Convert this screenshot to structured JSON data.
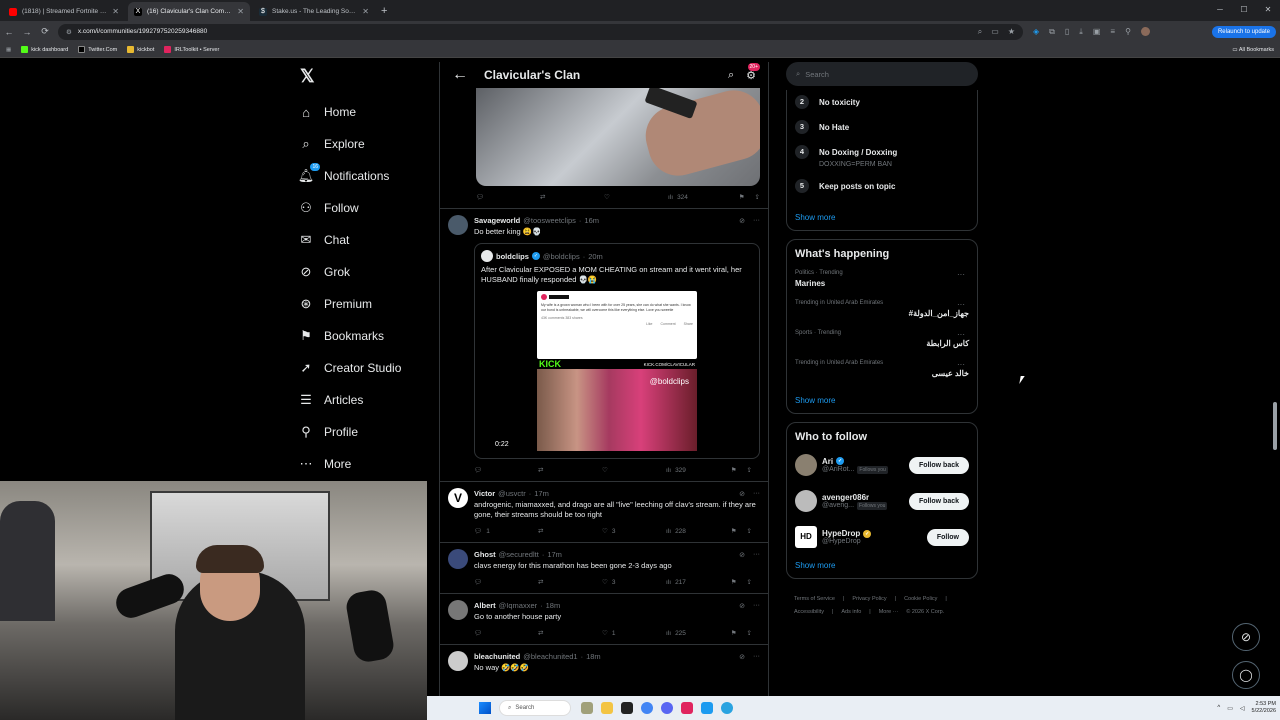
{
  "browser": {
    "tabs": [
      {
        "title": "(1818) | Streamed Fortnite for 1",
        "favicon_color": "#ff0000",
        "active": false
      },
      {
        "title": "(16) Clavicular's Clan Communi",
        "favicon_color": "#000000",
        "active": true
      },
      {
        "title": "Stake.us - The Leading Social C",
        "favicon_color": "#1a2c38",
        "active": false
      }
    ],
    "url": "x.com/i/communities/1992797520259346880",
    "relaunch_label": "Relaunch to update",
    "bookmarks": [
      {
        "label": "kick dashboard",
        "color": "#53fc18"
      },
      {
        "label": "Twitter.Com",
        "color": "#000000"
      },
      {
        "label": "kickbot",
        "color": "#e8b931"
      },
      {
        "label": "IRLToolkit • Server",
        "color": "#e0245e"
      }
    ],
    "all_bookmarks": "All Bookmarks"
  },
  "nav": {
    "items": [
      {
        "label": "Home",
        "icon": "home-icon"
      },
      {
        "label": "Explore",
        "icon": "search-icon"
      },
      {
        "label": "Notifications",
        "icon": "bell-icon",
        "badge": "16"
      },
      {
        "label": "Follow",
        "icon": "add-person-icon"
      },
      {
        "label": "Chat",
        "icon": "mail-icon"
      },
      {
        "label": "Grok",
        "icon": "grok-icon"
      },
      {
        "label": "Premium",
        "icon": "premium-icon"
      },
      {
        "label": "Bookmarks",
        "icon": "bookmark-icon"
      },
      {
        "label": "Creator Studio",
        "icon": "rocket-icon"
      },
      {
        "label": "Articles",
        "icon": "article-icon"
      },
      {
        "label": "Profile",
        "icon": "person-icon"
      },
      {
        "label": "More",
        "icon": "more-icon"
      }
    ]
  },
  "feed": {
    "title": "Clavicular's Clan",
    "header_badge": "20+",
    "first_post_stats": {
      "views": "324"
    },
    "posts": [
      {
        "name": "Savageworld",
        "handle": "@toosweetclips",
        "time": "16m",
        "text": "Do better king 😩💀",
        "avatar_color": "#4a5a6a",
        "quote": {
          "name": "boldclips",
          "handle": "@boldclips",
          "time": "20m",
          "text": "After Clavicular EXPOSED a MOM CHEATING on stream and it went viral, her HUSBAND finally responded 💀😭",
          "kick_text": "KICK",
          "kick_url": "KICK.COM/CLAVICULAR",
          "video_tag": "@boldclips",
          "duration": "0:22",
          "screenshot_text": "My wife is a grown woman who I been with for over 25 years, she can do what she wants. I know our bond is unbreakable, we will overcome this like everything else. Love you sweetie",
          "screenshot_stats": "43K comments  383 shares",
          "screenshot_actions": [
            "Like",
            "Comment",
            "Share"
          ]
        },
        "stats": {
          "replies": "",
          "reposts": "",
          "likes": "",
          "views": "329"
        }
      },
      {
        "name": "Victor",
        "handle": "@usvctr",
        "time": "17m",
        "text": "androgenic, miamaxxed, and drago are all \"live\" leeching off clav's stream. if they are gone, their streams should be too right",
        "avatar_color": "#ffffff",
        "stats": {
          "replies": "1",
          "reposts": "",
          "likes": "3",
          "views": "228"
        }
      },
      {
        "name": "Ghost",
        "handle": "@securedltt",
        "time": "17m",
        "text": "clavs energy for this marathon has been gone 2-3 days ago",
        "avatar_color": "#3a4a7a",
        "stats": {
          "replies": "",
          "reposts": "",
          "likes": "3",
          "views": "217"
        }
      },
      {
        "name": "Albert",
        "handle": "@Iqmaxxer",
        "time": "18m",
        "text": "Go to another house party",
        "avatar_color": "#777777",
        "stats": {
          "replies": "",
          "reposts": "",
          "likes": "1",
          "views": "225"
        }
      },
      {
        "name": "bleachunited",
        "handle": "@bleachunited1",
        "time": "18m",
        "text": "No way 🤣🤣🤣",
        "avatar_color": "#cccccc",
        "stats": {
          "replies": "",
          "reposts": "",
          "likes": "",
          "views": ""
        }
      }
    ]
  },
  "sidebar": {
    "search_placeholder": "Search",
    "rules": [
      {
        "n": "2",
        "title": "No toxicity",
        "sub": ""
      },
      {
        "n": "3",
        "title": "No Hate",
        "sub": ""
      },
      {
        "n": "4",
        "title": "No Doxing / Doxxing",
        "sub": "DOXXING=PERM BAN"
      },
      {
        "n": "5",
        "title": "Keep posts on topic",
        "sub": ""
      }
    ],
    "show_more": "Show more",
    "whats_happening": {
      "title": "What's happening",
      "trends": [
        {
          "category": "Politics · Trending",
          "title": "Marines",
          "rtl": false
        },
        {
          "category": "Trending in United Arab Emirates",
          "title": "#جهاز_امن_الدولة",
          "rtl": true
        },
        {
          "category": "Sports · Trending",
          "title": "كاس الرابطة",
          "rtl": true
        },
        {
          "category": "Trending in United Arab Emirates",
          "title": "خالد عيسى",
          "rtl": true
        }
      ]
    },
    "who_to_follow": {
      "title": "Who to follow",
      "users": [
        {
          "name": "Ari",
          "handle": "@AriRot...",
          "follows_you": "Follows you",
          "button": "Follow back",
          "verified": "blue",
          "avatar_color": "#8a8070"
        },
        {
          "name": "avenger086r",
          "handle": "@aveng...",
          "follows_you": "Follows you",
          "button": "Follow back",
          "verified": "",
          "avatar_color": "#bbbbbb"
        },
        {
          "name": "HypeDrop",
          "handle": "@HypeDrop",
          "follows_you": "",
          "button": "Follow",
          "verified": "gold",
          "avatar_color": "#ffffff"
        }
      ]
    },
    "footer_links": [
      "Terms of Service",
      "|",
      "Privacy Policy",
      "|",
      "Cookie Policy",
      "|",
      "Accessibility",
      "|",
      "Ads info",
      "|",
      "More ···",
      "© 2026 X Corp."
    ]
  },
  "taskbar": {
    "search_placeholder": "Search",
    "time": "2:53 PM",
    "date": "5/22/2026"
  }
}
